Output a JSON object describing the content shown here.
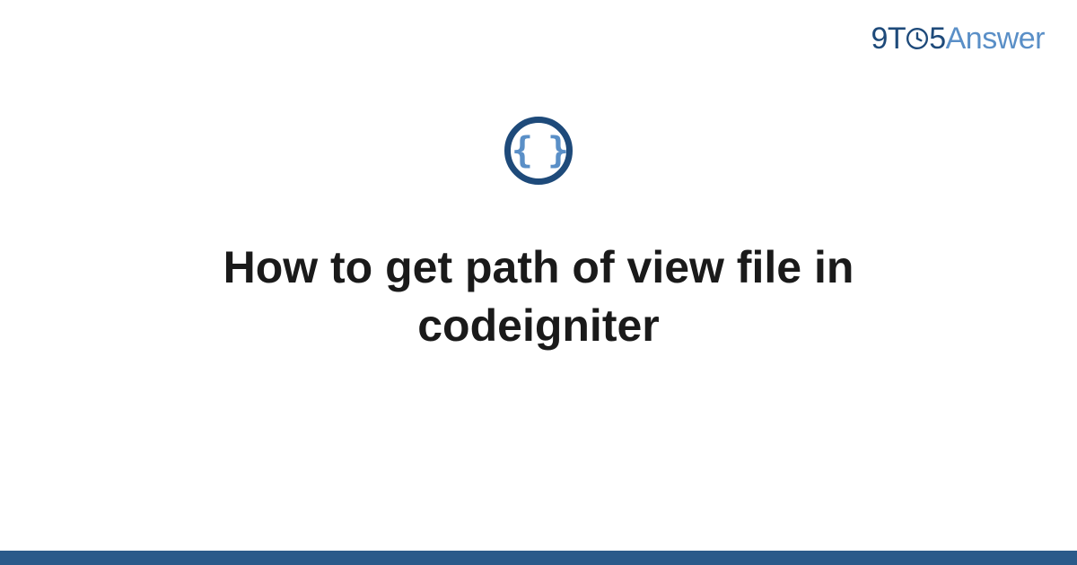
{
  "brand": {
    "part1": "9",
    "part2": "T",
    "part3": "5",
    "part4": "Answer"
  },
  "logo": {
    "braces": "{ }"
  },
  "title": "How to get path of view file in codeigniter",
  "colors": {
    "dark_blue": "#1e4a7a",
    "light_blue": "#5a8fc7",
    "footer": "#2a5a8a",
    "text": "#1a1a1a"
  }
}
